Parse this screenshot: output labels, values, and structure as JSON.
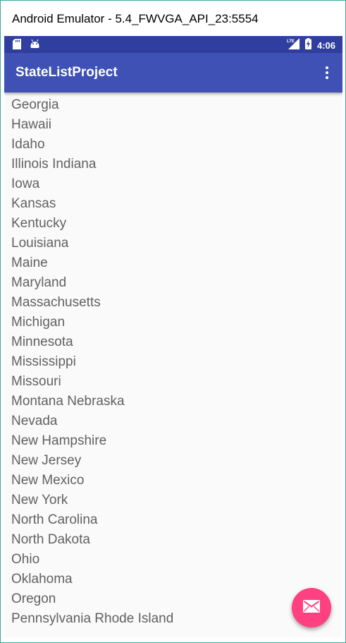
{
  "window": {
    "title": "Android Emulator - 5.4_FWVGA_API_23:5554"
  },
  "status_bar": {
    "time": "4:06",
    "network": "LTE",
    "icons": [
      "sd-card-icon",
      "android-icon",
      "signal-icon",
      "battery-charging-icon"
    ]
  },
  "app_bar": {
    "title": "StateListProject",
    "menu_icon": "overflow-menu-icon"
  },
  "states": [
    "Georgia",
    "Hawaii",
    "Idaho",
    "Illinois Indiana",
    "Iowa",
    "Kansas",
    "Kentucky",
    "Louisiana",
    "Maine",
    "Maryland",
    "Massachusetts",
    "Michigan",
    "Minnesota",
    "Mississippi",
    "Missouri",
    "Montana Nebraska",
    "Nevada",
    "New Hampshire",
    "New Jersey",
    "New Mexico",
    "New York",
    "North Carolina",
    "North Dakota",
    "Ohio",
    "Oklahoma",
    "Oregon",
    "Pennsylvania Rhode Island"
  ],
  "fab": {
    "icon": "email-icon"
  },
  "colors": {
    "primary": "#3f51b5",
    "primary_dark": "#303f9f",
    "accent": "#ff4081",
    "list_text": "#616161",
    "background": "#fafafa"
  }
}
